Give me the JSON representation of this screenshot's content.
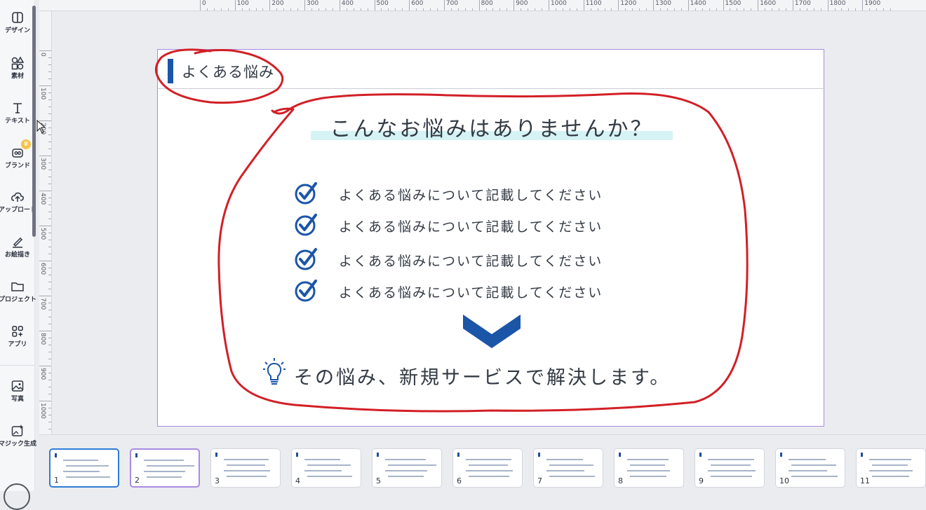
{
  "sidebar": {
    "items": [
      {
        "label": "デザイン",
        "icon": "layout-icon"
      },
      {
        "label": "素材",
        "icon": "shapes-icon"
      },
      {
        "label": "テキスト",
        "icon": "text-icon"
      },
      {
        "label": "ブランド",
        "icon": "brand-icon"
      },
      {
        "label": "アップロード",
        "icon": "upload-icon"
      },
      {
        "label": "お絵描き",
        "icon": "draw-icon"
      },
      {
        "label": "プロジェクト",
        "icon": "folder-icon"
      },
      {
        "label": "アプリ",
        "icon": "apps-icon"
      },
      {
        "label": "写真",
        "icon": "photo-icon"
      },
      {
        "label": "マジック生成",
        "icon": "magic-icon"
      }
    ]
  },
  "ruler": {
    "top": [
      "0",
      "100",
      "200",
      "300",
      "400",
      "500",
      "600",
      "700",
      "800",
      "900",
      "1000",
      "1100",
      "1200",
      "1300",
      "1400",
      "1500",
      "1600",
      "1700",
      "1800",
      "1900"
    ],
    "left": [
      "0",
      "100",
      "200",
      "300",
      "400",
      "500",
      "600",
      "700",
      "800",
      "900",
      "1000"
    ]
  },
  "slide": {
    "header": "よくある悩み",
    "question": "こんなお悩みはありませんか？",
    "items": [
      "よくある悩みについて記載してください",
      "よくある悩みについて記載してください",
      "よくある悩みについて記載してください",
      "よくある悩みについて記載してください"
    ],
    "answer": "その悩み、新規サービスで解決します。",
    "accent_color": "#1b55a8",
    "highlight_color": "#d5f3f5"
  },
  "pages": {
    "numbers": [
      "1",
      "2",
      "3",
      "4",
      "5",
      "6",
      "7",
      "8",
      "9",
      "10",
      "11"
    ],
    "selected": "1",
    "editing": "2"
  }
}
